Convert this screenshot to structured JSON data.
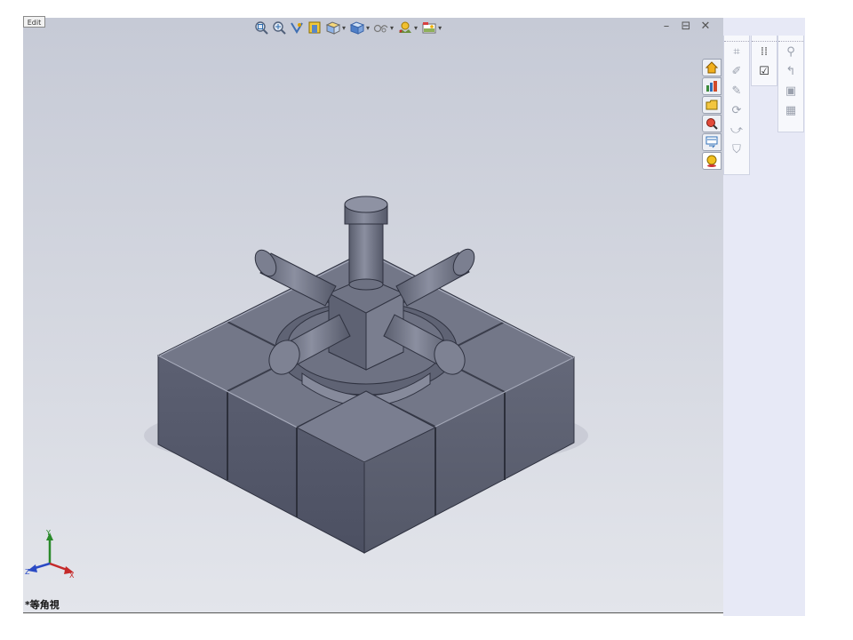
{
  "tab": {
    "label": "Edit"
  },
  "toolbar": {
    "items": [
      {
        "icon": "zoom-to-fit-icon"
      },
      {
        "icon": "zoom-to-area-icon"
      },
      {
        "icon": "previous-view-icon"
      },
      {
        "icon": "section-view-icon"
      },
      {
        "icon": "view-orientation-icon",
        "dropdown": true
      },
      {
        "icon": "display-style-icon",
        "dropdown": true
      },
      {
        "icon": "hide-show-items-icon",
        "dropdown": true
      },
      {
        "icon": "edit-appearance-icon",
        "dropdown": true
      },
      {
        "icon": "apply-scene-icon",
        "dropdown": true
      }
    ]
  },
  "window_controls": {
    "minimize": "–",
    "restore": "⊟",
    "close": "✕"
  },
  "task_pane_tabs": [
    {
      "icon": "home-icon"
    },
    {
      "icon": "design-library-icon"
    },
    {
      "icon": "file-explorer-icon"
    },
    {
      "icon": "search-icon"
    },
    {
      "icon": "view-palette-icon"
    },
    {
      "icon": "appearances-icon",
      "active": true
    }
  ],
  "status": {
    "view_name": "*等角視"
  },
  "triad": {
    "x_label": "X",
    "y_label": "Y",
    "z_label": "Z"
  },
  "colors": {
    "viewport_top": "#c6cad6",
    "viewport_bottom": "#e3e5eb",
    "model": "#6b6f80",
    "panel": "#e7e9f6"
  }
}
